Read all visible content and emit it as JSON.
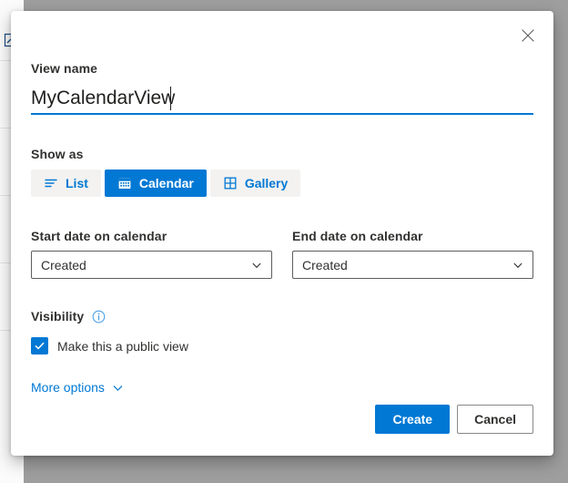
{
  "dialog": {
    "close_label": "Close",
    "view_name": {
      "label": "View name",
      "value": "MyCalendarView",
      "placeholder": "View name"
    },
    "show_as": {
      "label": "Show as",
      "options": [
        {
          "label": "List",
          "icon": "list-icon",
          "selected": false
        },
        {
          "label": "Calendar",
          "icon": "calendar-icon",
          "selected": true
        },
        {
          "label": "Gallery",
          "icon": "gallery-grid-icon",
          "selected": false
        }
      ]
    },
    "start_date": {
      "label": "Start date on calendar",
      "value": "Created"
    },
    "end_date": {
      "label": "End date on calendar",
      "value": "Created"
    },
    "visibility": {
      "label": "Visibility",
      "info_icon": "info-circle-icon",
      "checkbox_label": "Make this a public view",
      "checked": true
    },
    "more_options": {
      "label": "More options",
      "icon": "chevron-down-icon"
    },
    "footer": {
      "create_label": "Create",
      "cancel_label": "Cancel"
    }
  },
  "colors": {
    "accent": "#0078d4",
    "text": "#323130",
    "segment_unselected_bg": "#f3f2f1",
    "border": "#605e5c",
    "backdrop": "#9e9e9e"
  }
}
